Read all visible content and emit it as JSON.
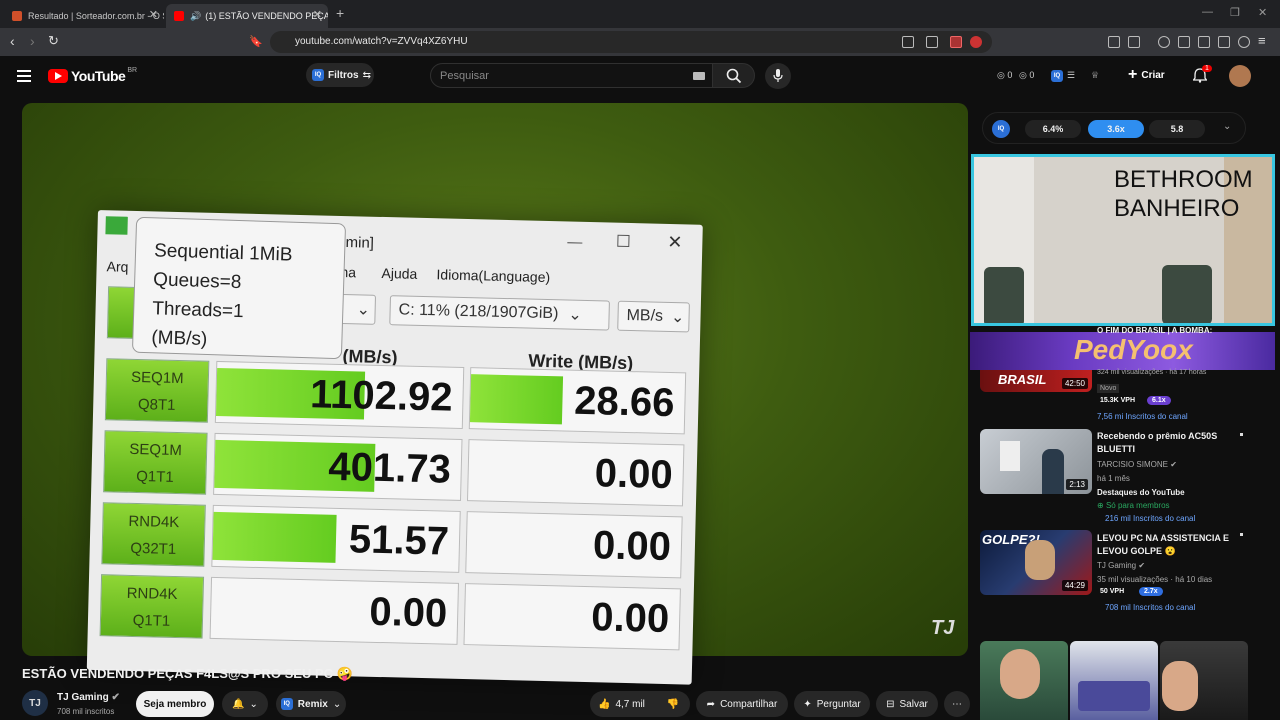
{
  "browser": {
    "tabs": [
      {
        "title": "Resultado | Sorteador.com.br - O Site"
      },
      {
        "title": "(1) ESTÃO VENDENDO PEÇAS"
      }
    ],
    "url": "youtube.com/watch?v=ZVVq4XZ6YHU"
  },
  "header": {
    "logo_text": "YouTube",
    "region": "BR",
    "filters_label": "Filtros",
    "search_placeholder": "Pesquisar",
    "counter_a": "0",
    "counter_b": "0",
    "create_label": "Criar",
    "notifications": "1"
  },
  "video": {
    "title": "ESTÃO VENDENDO PEÇAS F4LS@S PRO SEU PC 🤪",
    "watermark": "TJ",
    "cdm": {
      "window_title": "dmin]",
      "menu": [
        "Arq",
        "ma",
        "Ajuda",
        "Idioma(Language)"
      ],
      "drive_select": "C: 11% (218/1907GiB)",
      "unit_select": "MB/s",
      "read_header": "(MB/s)",
      "write_header": "Write (MB/s)",
      "tooltip": [
        "Sequential 1MiB",
        "Queues=8",
        "Threads=1",
        "(MB/s)"
      ],
      "rows": [
        {
          "l1": "SEQ1M",
          "l2": "Q8T1",
          "read": "1102.92",
          "write": "28.66"
        },
        {
          "l1": "SEQ1M",
          "l2": "Q1T1",
          "read": "401.73",
          "write": "0.00"
        },
        {
          "l1": "RND4K",
          "l2": "Q32T1",
          "read": "51.57",
          "write": "0.00"
        },
        {
          "l1": "RND4K",
          "l2": "Q1T1",
          "read": "0.00",
          "write": "0.00"
        }
      ],
      "read_fill": [
        0.6,
        0.65,
        0.5,
        0
      ],
      "write_fill": [
        0.43,
        0,
        0,
        0
      ]
    }
  },
  "channel": {
    "name": "TJ Gaming",
    "subs": "708 mil inscritos",
    "avatar": "TJ",
    "member_label": "Seja membro",
    "remix_label": "Remix"
  },
  "actions": {
    "likes": "4,7 mil",
    "share": "Compartilhar",
    "ask": "Perguntar",
    "save": "Salvar"
  },
  "iq_stats": {
    "a": "6.4%",
    "b": "3.6x",
    "c": "5.8"
  },
  "miniplayer": {
    "line1": "BETHROOM",
    "line2": "BANHEIRO"
  },
  "banner": {
    "text": "PedYoox"
  },
  "related": [
    {
      "title": "O FIM DO BRASIL | A BOMBA:",
      "duration": "42:50",
      "meta": "324 mil visualizações · há 17 horas",
      "badge": "Novo",
      "vph": "15.3K VPH",
      "mult": "6.1x",
      "subs": "7,56 mi Inscritos do canal",
      "thumb_text": "BRASIL"
    },
    {
      "title": "Recebendo o prêmio AC50S BLUETTI",
      "duration": "2:13",
      "channel": "TARCISIO SIMONE",
      "meta": "há 1 mês",
      "highlight": "Destaques do YouTube",
      "members": "Só para membros",
      "subs": "216 mil Inscritos do canal"
    },
    {
      "title": "LEVOU PC NA ASSISTENCIA E LEVOU GOLPE 😮",
      "duration": "44:29",
      "channel": "TJ Gaming",
      "meta": "35 mil visualizações · há 10 dias",
      "vph": "50 VPH",
      "mult": "2.7x",
      "subs": "708 mil Inscritos do canal",
      "thumb_text": "GOLPE?!"
    }
  ]
}
